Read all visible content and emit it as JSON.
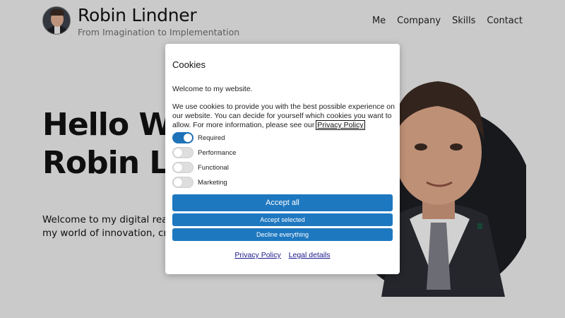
{
  "header": {
    "name": "Robin Lindner",
    "tagline": "From Imagination to Implementation",
    "nav": [
      "Me",
      "Company",
      "Skills",
      "Contact"
    ]
  },
  "hero": {
    "title_line1": "Hello Wor",
    "title_line2": "Robin Lin",
    "text": "Welcome to my digital realm! Developer and the brains behi my world of innovation, creati technological excellence."
  },
  "cookie_dialog": {
    "title": "Cookies",
    "welcome": "Welcome to my website.",
    "body_text": "We use cookies to provide you with the best possible experience on our website. You can decide for yourself which cookies you want to allow. For more information, please see our",
    "body_link": "Privacy Policy",
    "toggles": [
      {
        "label": "Required",
        "on": true
      },
      {
        "label": "Performance",
        "on": false
      },
      {
        "label": "Functional",
        "on": false
      },
      {
        "label": "Marketing",
        "on": false
      }
    ],
    "accept_all": "Accept all",
    "accept_selected": "Accept selected",
    "decline": "Decline everything",
    "links": [
      "Privacy Policy",
      "Legal details"
    ]
  },
  "colors": {
    "accent": "#1e78c0",
    "background": "#e6e6e6"
  }
}
